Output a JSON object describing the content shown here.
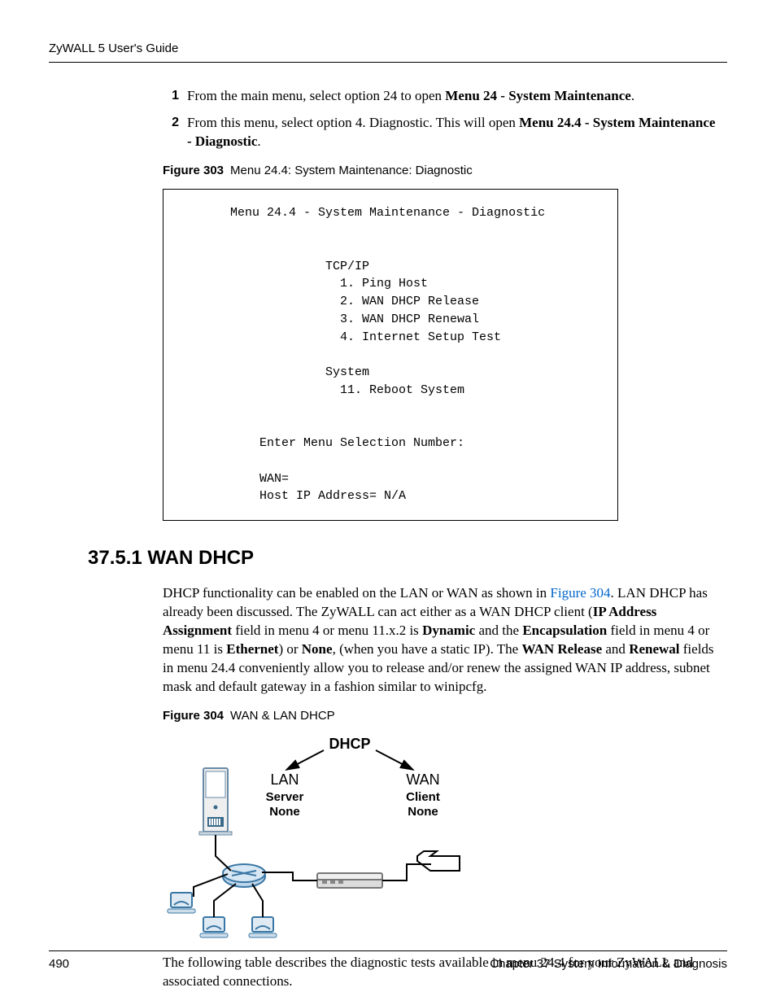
{
  "header": {
    "guide": "ZyWALL 5 User's Guide"
  },
  "steps": [
    {
      "num": "1",
      "plain1": "From the main menu, select option 24 to open ",
      "bold1": "Menu 24 - System Maintenance",
      "plain2": "."
    },
    {
      "num": "2",
      "plain1": "From this menu, select option 4. Diagnostic. This will open ",
      "bold1": "Menu 24.4 - System Maintenance - Diagnostic",
      "plain2": "."
    }
  ],
  "figure303": {
    "label": "Figure 303",
    "title": "Menu 24.4: System Maintenance: Diagnostic",
    "terminal": "      Menu 24.4 - System Maintenance - Diagnostic\n\n\n                   TCP/IP\n                     1. Ping Host\n                     2. WAN DHCP Release\n                     3. WAN DHCP Renewal\n                     4. Internet Setup Test\n\n                   System\n                     11. Reboot System\n\n\n          Enter Menu Selection Number:\n\n          WAN=\n          Host IP Address= N/A"
  },
  "section": {
    "heading": "37.5.1  WAN DHCP"
  },
  "para1": {
    "t1": "DHCP functionality can be enabled on the LAN or WAN as shown in ",
    "link": "Figure 304",
    "t2": ". LAN DHCP has already been discussed. The ZyWALL can act either as a WAN DHCP client (",
    "b1": "IP Address Assignment",
    "t3": " field in menu 4 or menu 11.x.2 is ",
    "b2": "Dynamic",
    "t4": " and the ",
    "b3": "Encapsulation",
    "t5": " field in menu 4 or menu 11 is ",
    "b4": "Ethernet",
    "t6": ") or ",
    "b5": "None",
    "t7": ", (when you have a static IP). The ",
    "b6": "WAN Release",
    "t8": " and ",
    "b7": "Renewal",
    "t9": " fields in menu 24.4 conveniently allow you to release and/or renew the assigned WAN IP address, subnet mask and default gateway in a fashion similar to winipcfg."
  },
  "figure304": {
    "label": "Figure 304",
    "title": "WAN & LAN DHCP"
  },
  "diagram": {
    "dhcp": "DHCP",
    "lan": "LAN",
    "wan": "WAN",
    "server": "Server",
    "none": "None",
    "client": "Client"
  },
  "para2": {
    "text": "The following table describes the diagnostic tests available in menu 24.4 for your ZyWALL and associated connections."
  },
  "footer": {
    "pagenum": "490",
    "chapter": "Chapter 37 System Information & Diagnosis"
  }
}
